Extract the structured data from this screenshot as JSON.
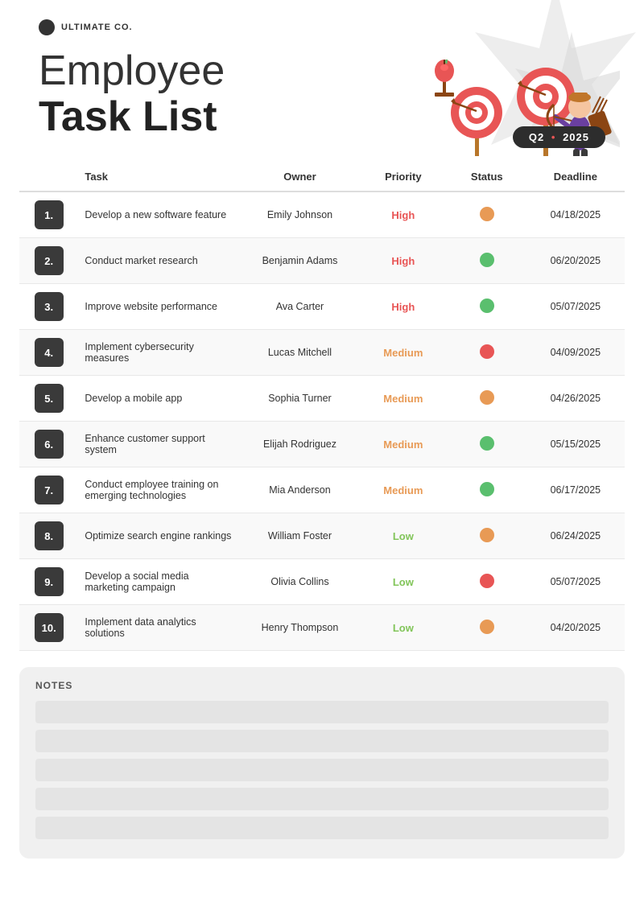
{
  "logo": {
    "text": "ULTIMATE CO."
  },
  "header": {
    "title_line1": "Employee",
    "title_line2": "Task List",
    "quarter": "Q2",
    "dot": "•",
    "year": "2025"
  },
  "table": {
    "columns": [
      "",
      "Task",
      "Owner",
      "Priority",
      "Status",
      "Deadline"
    ],
    "rows": [
      {
        "num": "1.",
        "task": "Develop a new software feature",
        "owner": "Emily Johnson",
        "priority": "High",
        "priority_class": "high",
        "status": "orange",
        "deadline": "04/18/2025"
      },
      {
        "num": "2.",
        "task": "Conduct market research",
        "owner": "Benjamin Adams",
        "priority": "High",
        "priority_class": "high",
        "status": "green",
        "deadline": "06/20/2025"
      },
      {
        "num": "3.",
        "task": "Improve website performance",
        "owner": "Ava Carter",
        "priority": "High",
        "priority_class": "high",
        "status": "green",
        "deadline": "05/07/2025"
      },
      {
        "num": "4.",
        "task": "Implement cybersecurity measures",
        "owner": "Lucas Mitchell",
        "priority": "Medium",
        "priority_class": "medium",
        "status": "red",
        "deadline": "04/09/2025"
      },
      {
        "num": "5.",
        "task": "Develop a mobile app",
        "owner": "Sophia Turner",
        "priority": "Medium",
        "priority_class": "medium",
        "status": "orange",
        "deadline": "04/26/2025"
      },
      {
        "num": "6.",
        "task": "Enhance customer support system",
        "owner": "Elijah Rodriguez",
        "priority": "Medium",
        "priority_class": "medium",
        "status": "green",
        "deadline": "05/15/2025"
      },
      {
        "num": "7.",
        "task": "Conduct employee training on emerging technologies",
        "owner": "Mia Anderson",
        "priority": "Medium",
        "priority_class": "medium",
        "status": "green",
        "deadline": "06/17/2025"
      },
      {
        "num": "8.",
        "task": "Optimize search engine rankings",
        "owner": "William Foster",
        "priority": "Low",
        "priority_class": "low",
        "status": "orange",
        "deadline": "06/24/2025"
      },
      {
        "num": "9.",
        "task": "Develop a social media marketing campaign",
        "owner": "Olivia Collins",
        "priority": "Low",
        "priority_class": "low",
        "status": "red",
        "deadline": "05/07/2025"
      },
      {
        "num": "10.",
        "task": "Implement data analytics solutions",
        "owner": "Henry Thompson",
        "priority": "Low",
        "priority_class": "low",
        "status": "orange",
        "deadline": "04/20/2025"
      }
    ]
  },
  "notes": {
    "title": "NOTES",
    "lines": 5
  }
}
